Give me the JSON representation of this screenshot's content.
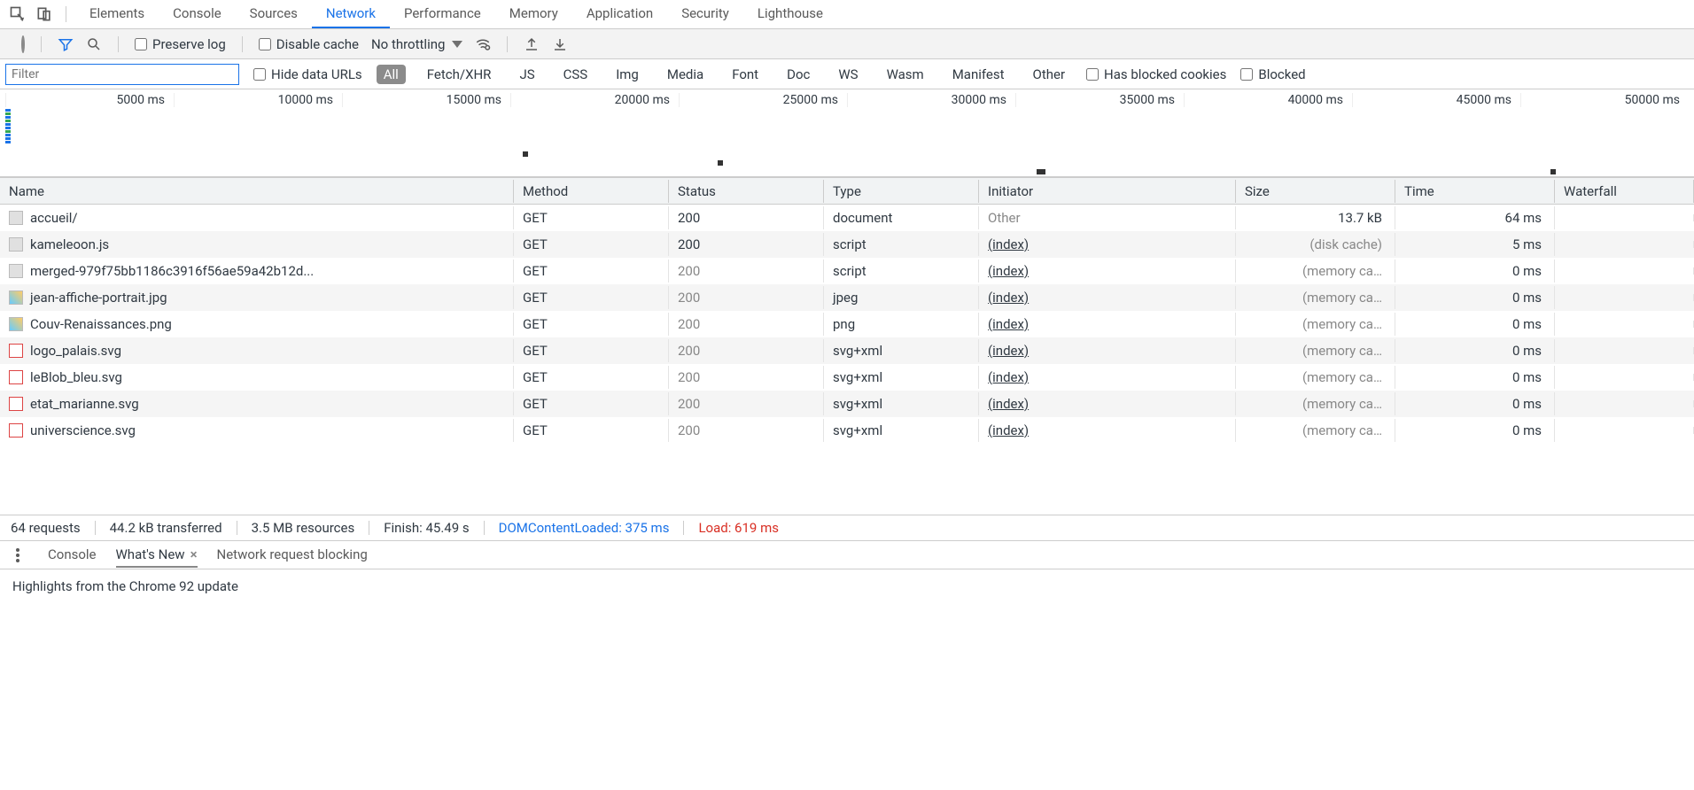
{
  "header": {
    "tabs": [
      "Elements",
      "Console",
      "Sources",
      "Network",
      "Performance",
      "Memory",
      "Application",
      "Security",
      "Lighthouse"
    ],
    "active_tab": "Network"
  },
  "toolbar": {
    "preserve_log": "Preserve log",
    "disable_cache": "Disable cache",
    "throttling": "No throttling"
  },
  "filterbar": {
    "filter_placeholder": "Filter",
    "hide_data_urls": "Hide data URLs",
    "types": [
      "All",
      "Fetch/XHR",
      "JS",
      "CSS",
      "Img",
      "Media",
      "Font",
      "Doc",
      "WS",
      "Wasm",
      "Manifest",
      "Other"
    ],
    "active_type": "All",
    "has_blocked_cookies": "Has blocked cookies",
    "blocked": "Blocked"
  },
  "timeline": {
    "ticks": [
      "5000 ms",
      "10000 ms",
      "15000 ms",
      "20000 ms",
      "25000 ms",
      "30000 ms",
      "35000 ms",
      "40000 ms",
      "45000 ms",
      "50000 ms"
    ]
  },
  "columns": [
    "Name",
    "Method",
    "Status",
    "Type",
    "Initiator",
    "Size",
    "Time",
    "Waterfall"
  ],
  "requests": [
    {
      "name": "accueil/",
      "method": "GET",
      "status": "200",
      "type": "document",
      "initiator": "Other",
      "initiator_link": false,
      "size": "13.7 kB",
      "time": "64 ms",
      "status_muted": false,
      "icon": "doc"
    },
    {
      "name": "kameleoon.js",
      "method": "GET",
      "status": "200",
      "type": "script",
      "initiator": "(index)",
      "initiator_link": true,
      "size": "(disk cache)",
      "time": "5 ms",
      "status_muted": false,
      "icon": "doc"
    },
    {
      "name": "merged-979f75bb1186c3916f56ae59a42b12d...",
      "method": "GET",
      "status": "200",
      "type": "script",
      "initiator": "(index)",
      "initiator_link": true,
      "size": "(memory ca…",
      "time": "0 ms",
      "status_muted": true,
      "icon": "doc"
    },
    {
      "name": "jean-affiche-portrait.jpg",
      "method": "GET",
      "status": "200",
      "type": "jpeg",
      "initiator": "(index)",
      "initiator_link": true,
      "size": "(memory ca…",
      "time": "0 ms",
      "status_muted": true,
      "icon": "img"
    },
    {
      "name": "Couv-Renaissances.png",
      "method": "GET",
      "status": "200",
      "type": "png",
      "initiator": "(index)",
      "initiator_link": true,
      "size": "(memory ca…",
      "time": "0 ms",
      "status_muted": true,
      "icon": "img"
    },
    {
      "name": "logo_palais.svg",
      "method": "GET",
      "status": "200",
      "type": "svg+xml",
      "initiator": "(index)",
      "initiator_link": true,
      "size": "(memory ca…",
      "time": "0 ms",
      "status_muted": true,
      "icon": "svg"
    },
    {
      "name": "leBlob_bleu.svg",
      "method": "GET",
      "status": "200",
      "type": "svg+xml",
      "initiator": "(index)",
      "initiator_link": true,
      "size": "(memory ca…",
      "time": "0 ms",
      "status_muted": true,
      "icon": "svg"
    },
    {
      "name": "etat_marianne.svg",
      "method": "GET",
      "status": "200",
      "type": "svg+xml",
      "initiator": "(index)",
      "initiator_link": true,
      "size": "(memory ca…",
      "time": "0 ms",
      "status_muted": true,
      "icon": "svg"
    },
    {
      "name": "universcience.svg",
      "method": "GET",
      "status": "200",
      "type": "svg+xml",
      "initiator": "(index)",
      "initiator_link": true,
      "size": "(memory ca…",
      "time": "0 ms",
      "status_muted": true,
      "icon": "svg"
    }
  ],
  "summary": {
    "requests": "64 requests",
    "transferred": "44.2 kB transferred",
    "resources": "3.5 MB resources",
    "finish": "Finish: 45.49 s",
    "dcl": "DOMContentLoaded: 375 ms",
    "load": "Load: 619 ms"
  },
  "bottom": {
    "tabs": [
      "Console",
      "What's New",
      "Network request blocking"
    ],
    "active_tab": "What's New",
    "content": "Highlights from the Chrome 92 update"
  }
}
